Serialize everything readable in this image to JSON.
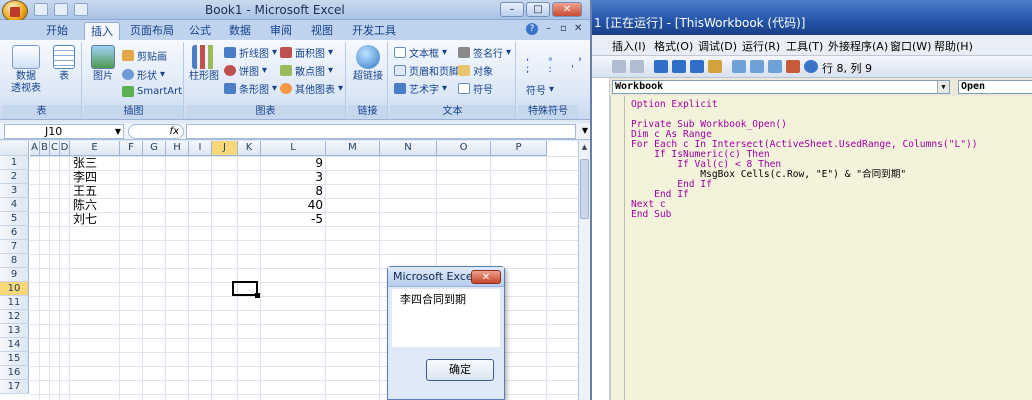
{
  "excel": {
    "title": "Book1 - Microsoft Excel",
    "tabs": [
      "开始",
      "插入",
      "页面布局",
      "公式",
      "数据",
      "审阅",
      "视图",
      "开发工具"
    ],
    "active_tab": "插入",
    "ribbon": {
      "group_table": {
        "label": "表",
        "btn_pivot": "数据\n透视表",
        "btn_table": "表"
      },
      "group_illus": {
        "label": "插图",
        "btn_picture": "图片",
        "btn_clipart": "剪贴画",
        "btn_shapes": "形状",
        "btn_smartart": "SmartArt"
      },
      "group_charts": {
        "label": "图表",
        "btn_column": "柱形图",
        "btn_line": "折线图",
        "btn_pie": "饼图",
        "btn_bar": "条形图",
        "btn_area": "面积图",
        "btn_scatter": "散点图",
        "btn_other": "其他图表"
      },
      "group_links": {
        "label": "链接",
        "btn_hyperlink": "超链接"
      },
      "group_text": {
        "label": "文本",
        "btn_textbox": "文本框",
        "btn_headerfooter": "页眉和页脚",
        "btn_wordart": "艺术字",
        "btn_signature": "签名行",
        "btn_object": "对象",
        "btn_symbol": "符号"
      },
      "group_special": {
        "label": "特殊符号",
        "btn_symbol": "符号"
      }
    },
    "namebox": "J10",
    "fx": "fx",
    "columns": [
      "A",
      "B",
      "C",
      "D",
      "E",
      "F",
      "G",
      "H",
      "I",
      "J",
      "K",
      "L",
      "M",
      "N",
      "O",
      "P"
    ],
    "selected_column": "J",
    "rows": [
      "1",
      "2",
      "3",
      "4",
      "5",
      "6",
      "7",
      "8",
      "9",
      "10",
      "11",
      "12",
      "13",
      "14",
      "15",
      "16",
      "17"
    ],
    "selected_row": "10",
    "data": [
      {
        "name": "张三",
        "value": "9"
      },
      {
        "name": "李四",
        "value": "3"
      },
      {
        "name": "王五",
        "value": "8"
      },
      {
        "name": "陈六",
        "value": "40"
      },
      {
        "name": "刘七",
        "value": "-5"
      }
    ]
  },
  "dialog": {
    "title": "Microsoft Excel",
    "message": "李四合同到期",
    "ok": "确定",
    "close": "✕"
  },
  "vbe": {
    "title": "1 [正在运行] - [ThisWorkbook (代码)]",
    "menu": [
      "插入(I)",
      "格式(O)",
      "调试(D)",
      "运行(R)",
      "工具(T)",
      "外接程序(A)",
      "窗口(W)",
      "帮助(H)"
    ],
    "position": "行 8, 列 9",
    "object_dropdown": "Workbook",
    "proc_dropdown": "Open",
    "code": [
      "Option Explicit",
      "Private Sub Workbook_Open()",
      "Dim c As Range",
      "For Each c In Intersect(ActiveSheet.UsedRange, Columns(\"L\"))",
      "    If IsNumeric(c) Then",
      "        If Val(c) < 8 Then",
      "            MsgBox Cells(c.Row, \"E\") & \"合同到期\"",
      "        End If",
      "    End If",
      "Next c",
      "End Sub"
    ]
  }
}
